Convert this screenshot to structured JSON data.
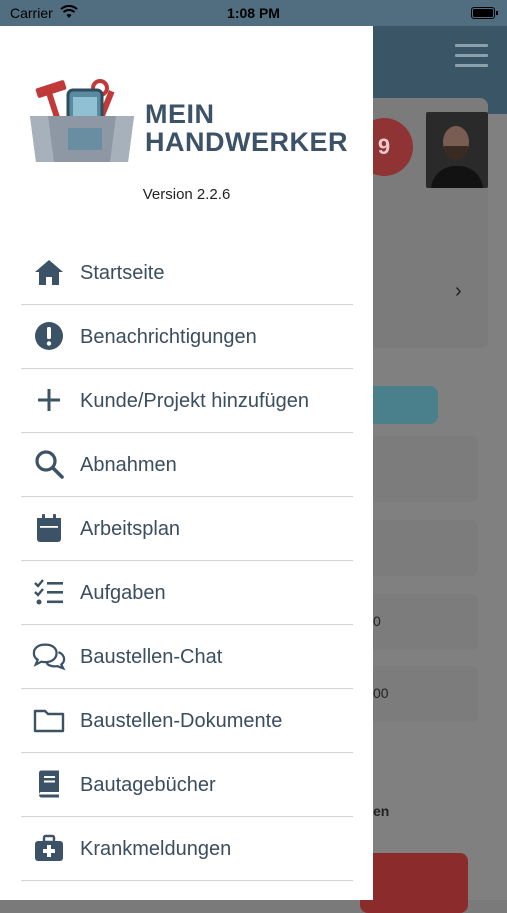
{
  "status_bar": {
    "carrier": "Carrier",
    "time": "1:08 PM"
  },
  "drawer": {
    "brand_line1": "MEIN",
    "brand_line2": "HANDWERKER",
    "version": "Version 2.2.6",
    "items": [
      {
        "label": "Startseite",
        "icon": "home-icon"
      },
      {
        "label": "Benachrichtigungen",
        "icon": "alert-circle-icon"
      },
      {
        "label": "Kunde/Projekt hinzufügen",
        "icon": "plus-icon"
      },
      {
        "label": "Abnahmen",
        "icon": "search-icon"
      },
      {
        "label": "Arbeitsplan",
        "icon": "calendar-icon"
      },
      {
        "label": "Aufgaben",
        "icon": "checklist-icon"
      },
      {
        "label": "Baustellen-Chat",
        "icon": "chat-icon"
      },
      {
        "label": "Baustellen-Dokumente",
        "icon": "folder-icon"
      },
      {
        "label": "Bautagebücher",
        "icon": "book-icon"
      },
      {
        "label": "Krankmeldungen",
        "icon": "medical-case-icon"
      }
    ]
  },
  "background": {
    "badge": "9",
    "row_value_1": "0",
    "row_value_2": "00",
    "partial_text": "en"
  },
  "colors": {
    "accent": "#3c5266",
    "divider": "#d0d4d8",
    "header": "#506e80"
  }
}
